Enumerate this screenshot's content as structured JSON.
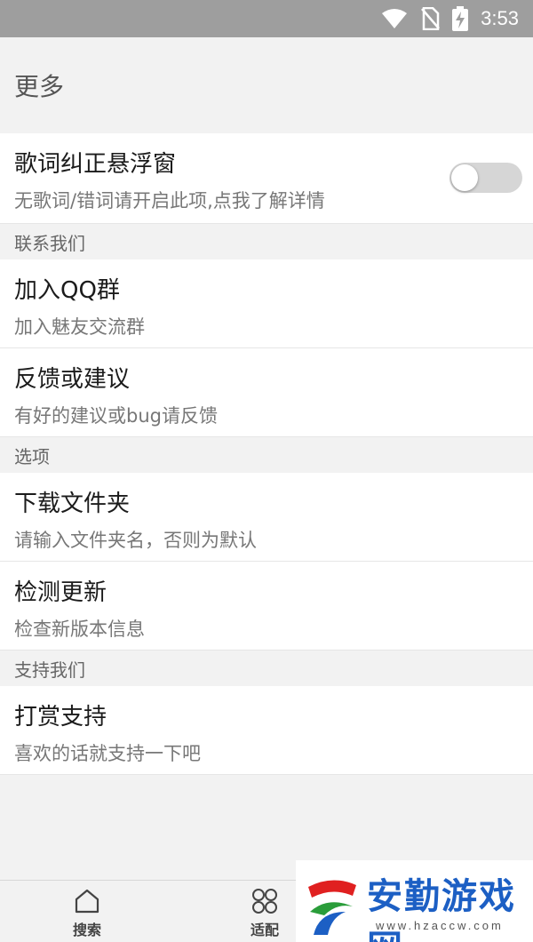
{
  "status_bar": {
    "time": "3:53",
    "icons": [
      "wifi-icon",
      "no-sim-icon",
      "battery-charging-icon"
    ]
  },
  "page": {
    "title": "更多"
  },
  "settings": {
    "lyrics": {
      "title": "歌词纠正悬浮窗",
      "subtitle": "无歌词/错词请开启此项,点我了解详情",
      "toggle_on": false
    },
    "contact_section": "联系我们",
    "qq_group": {
      "title": "加入QQ群",
      "subtitle": "加入魅友交流群"
    },
    "feedback": {
      "title": "反馈或建议",
      "subtitle": "有好的建议或bug请反馈"
    },
    "options_section": "选项",
    "download_folder": {
      "title": "下载文件夹",
      "subtitle": "请输入文件夹名，否则为默认"
    },
    "check_update": {
      "title": "检测更新",
      "subtitle": "检查新版本信息"
    },
    "support_section": "支持我们",
    "donate": {
      "title": "打赏支持",
      "subtitle": "喜欢的话就支持一下吧"
    }
  },
  "bottom_nav": {
    "search_label": "搜索",
    "adapt_label": "适配"
  },
  "watermark": {
    "text": "安勤游戏网",
    "url": "www.hzaccw.com"
  },
  "colors": {
    "status_bar": "#9e9e9e",
    "background": "#f2f2f2",
    "watermark_blue": "#1c5fc4"
  }
}
